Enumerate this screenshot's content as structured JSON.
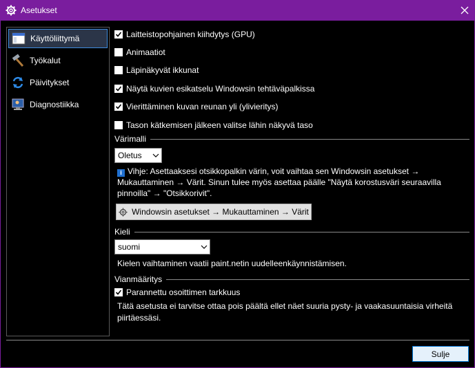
{
  "window": {
    "title": "Asetukset"
  },
  "sidebar": {
    "items": [
      {
        "label": "Käyttöliittymä",
        "icon": "window-icon",
        "active": true
      },
      {
        "label": "Työkalut",
        "icon": "hammer-icon",
        "active": false
      },
      {
        "label": "Päivitykset",
        "icon": "refresh-icon",
        "active": false
      },
      {
        "label": "Diagnostiikka",
        "icon": "monitor-icon",
        "active": false
      }
    ]
  },
  "options": {
    "gpu": {
      "label": "Laitteistopohjainen kiihdytys (GPU)",
      "checked": true
    },
    "animations": {
      "label": "Animaatiot",
      "checked": false
    },
    "transparent": {
      "label": "Läpinäkyvät ikkunat",
      "checked": false
    },
    "thumbnails": {
      "label": "Näytä kuvien esikatselu Windowsin tehtäväpalkissa",
      "checked": true
    },
    "overscroll": {
      "label": "Vierittäminen kuvan reunan yli (ylivieritys)",
      "checked": true
    },
    "layer": {
      "label": "Tason kätkemisen jälkeen valitse lähin näkyvä taso",
      "checked": false
    }
  },
  "colorscheme": {
    "section": "Värimalli",
    "selected": "Oletus",
    "hint": "Vihje: Asettaaksesi otsikkopalkin värin, voit vaihtaa sen Windowsin asetukset → Mukauttaminen → Värit. Sinun tulee myös asettaa päälle \"Näytä korostusväri seuraavilla pinnoilla\" → \"Otsikkorivit\".",
    "button": "Windowsin asetukset → Mukauttaminen → Värit"
  },
  "language": {
    "section": "Kieli",
    "selected": "suomi",
    "note": "Kielen vaihtaminen vaatii paint.netin uudelleenkäynnistämisen."
  },
  "diagnostics": {
    "section": "Vianmääritys",
    "option": {
      "label": "Parannettu osoittimen tarkkuus",
      "checked": true
    },
    "note": "Tätä asetusta ei tarvitse ottaa pois päältä ellet näet suuria pysty- ja vaakasuuntaisia virheitä piirtäessäsi."
  },
  "footer": {
    "close": "Sulje"
  },
  "colors": {
    "accent": "#7a1d9e",
    "selection": "#3e8de0",
    "info": "#1f6fcf"
  }
}
